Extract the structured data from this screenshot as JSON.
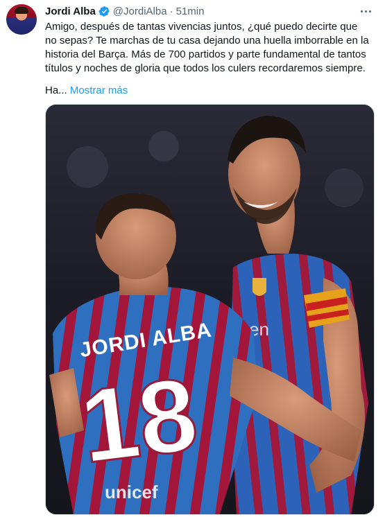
{
  "author": {
    "name": "Jordi Alba",
    "handle": "@JordiAlba",
    "separator": "·",
    "time": "51min",
    "verified_icon": "verified-badge-icon",
    "verified_color": "#1d9bf0"
  },
  "tweet": {
    "text": "Amigo, después de tantas vivencias juntos, ¿qué puedo decirte que no sepas? Te marchas de tu casa dejando una huella imborrable en la historia del Barça. Más de 700 partidos y parte fundamental de tantos títulos y noches de gloria que todos los culers recordaremos siempre.",
    "truncated_text": "Ha...",
    "show_more_label": "Mostrar más",
    "link_color": "#1d9bf0"
  },
  "media": {
    "jersey_name": "JORDI ALBA",
    "jersey_number": "18",
    "sponsor": "unicef",
    "chest_sponsor_fragment": "ken"
  }
}
